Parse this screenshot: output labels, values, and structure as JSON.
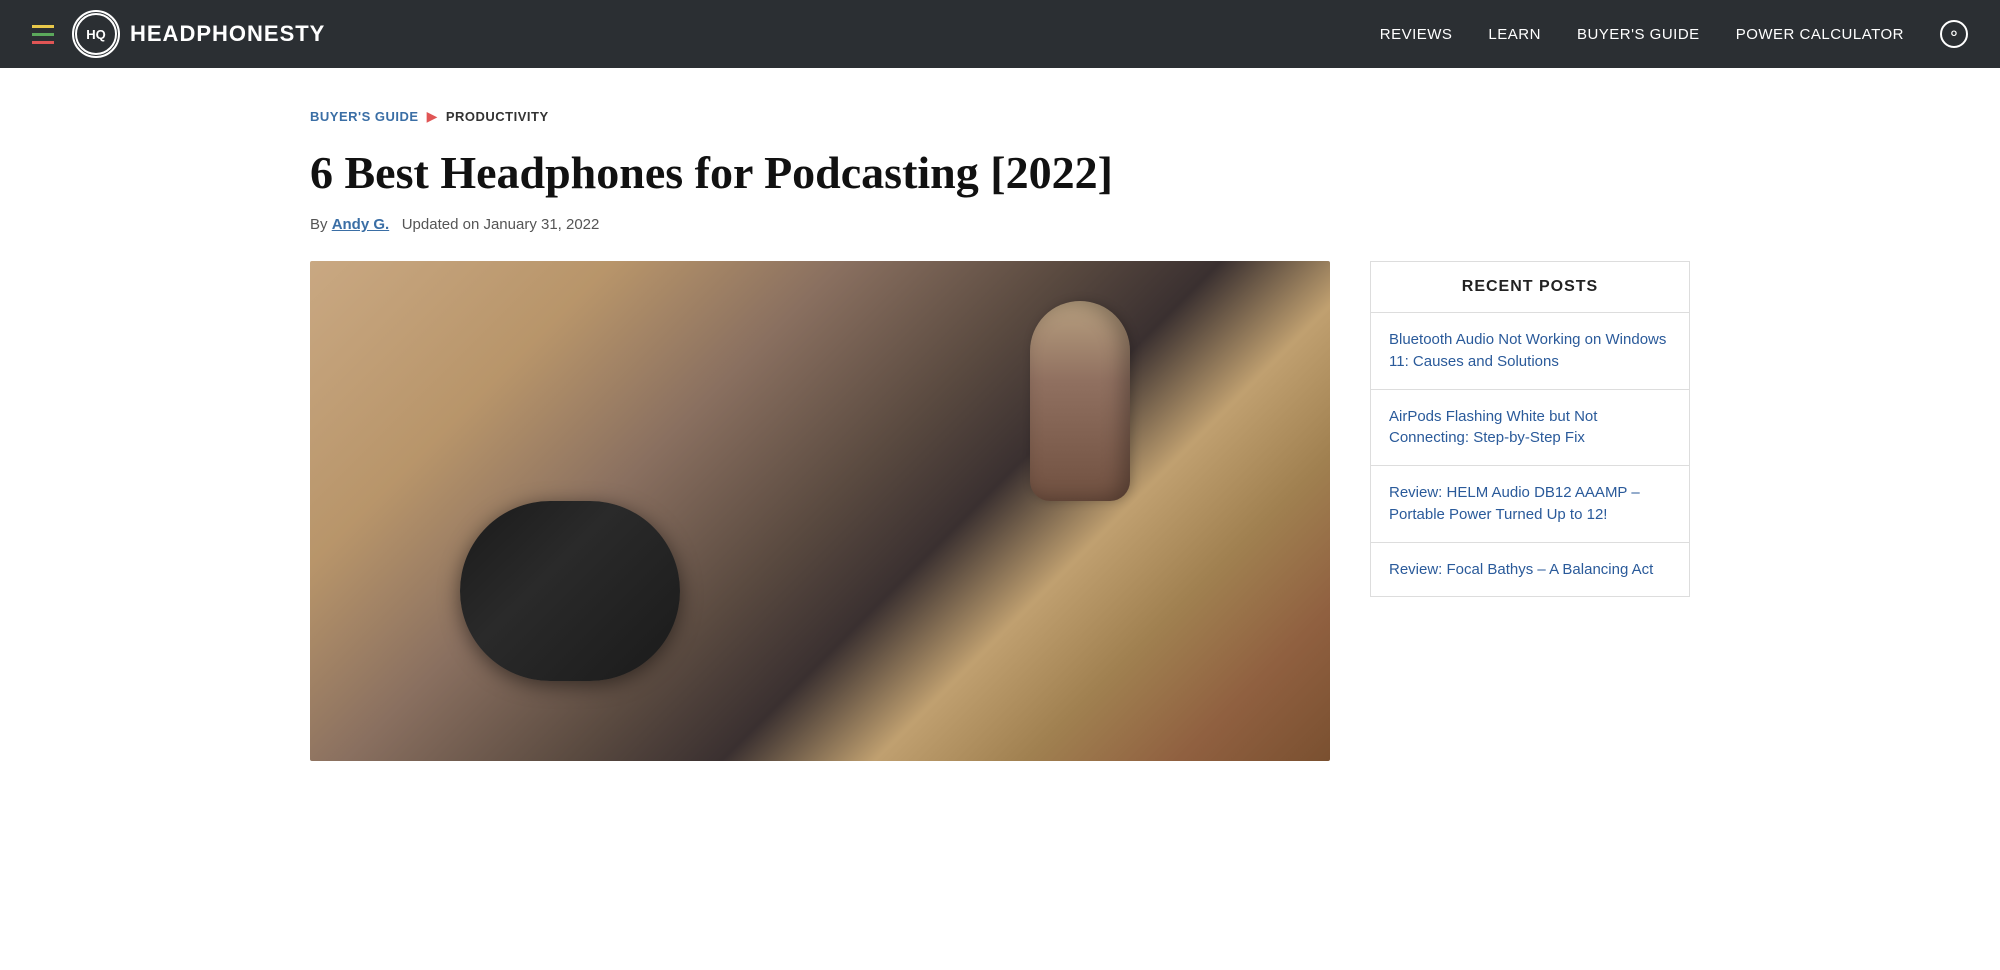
{
  "nav": {
    "hamburger_label": "Menu",
    "logo_text": "HQ",
    "brand": "HEADPHONESTY",
    "links": [
      {
        "label": "REVIEWS",
        "id": "reviews"
      },
      {
        "label": "LEARN",
        "id": "learn"
      },
      {
        "label": "BUYER'S GUIDE",
        "id": "buyers-guide"
      },
      {
        "label": "POWER CALCULATOR",
        "id": "power-calculator"
      }
    ],
    "search_label": "Search"
  },
  "breadcrumb": {
    "parent": "BUYER'S GUIDE",
    "separator": "▶",
    "current": "PRODUCTIVITY"
  },
  "article": {
    "title": "6 Best Headphones for Podcasting [2022]",
    "by_label": "By",
    "author": "Andy G.",
    "updated_label": "Updated on January 31, 2022"
  },
  "sidebar": {
    "recent_posts_label": "RECENT POSTS",
    "posts": [
      {
        "title": "Bluetooth Audio Not Working on Windows 11: Causes and Solutions"
      },
      {
        "title": "AirPods Flashing White but Not Connecting: Step-by-Step Fix"
      },
      {
        "title": "Review: HELM Audio DB12 AAAMP – Portable Power Turned Up to 12!"
      },
      {
        "title": "Review: Focal Bathys – A Balancing Act"
      }
    ]
  }
}
